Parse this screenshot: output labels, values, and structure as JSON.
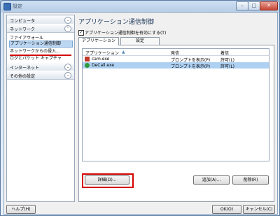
{
  "window": {
    "title": "設定"
  },
  "sidebar": {
    "categories": [
      {
        "label": "コンピュータ"
      },
      {
        "label": "ネットワーク"
      },
      {
        "label": "インターネット"
      },
      {
        "label": "その他の設定"
      }
    ],
    "network_items": [
      {
        "label": "ファイアウォール"
      },
      {
        "label": "アプリケーション通信制御"
      },
      {
        "label": "ネットワークからの侵入..."
      },
      {
        "label": "ログとパケット キャプチャ"
      }
    ]
  },
  "main": {
    "heading": "アプリケーション通信制御",
    "enable_checkbox": {
      "label": "アプリケーション通信制御を有効にする(T)",
      "checked": true
    },
    "tabs": [
      {
        "label": "アプリケーション"
      },
      {
        "label": "設定"
      }
    ],
    "list": {
      "columns": [
        "アプリケーション",
        "発信",
        "着信"
      ],
      "rows": [
        {
          "name": "cam.exe",
          "outbound": "プロンプトを表示(P)",
          "inbound": "許可(L)",
          "icon": "cam-app-icon",
          "selected": false
        },
        {
          "name": "DeCall.exe",
          "outbound": "プロンプトを表示(P)",
          "inbound": "許可(L)",
          "icon": "decall-app-icon",
          "selected": true
        }
      ]
    },
    "buttons": {
      "details": "詳細(D)...",
      "add": "追加(A)...",
      "remove": "削除(R)"
    }
  },
  "footer": {
    "help": "ヘルプ(H)",
    "ok": "OK(O)",
    "cancel": "キャンセル(C)"
  },
  "colors": {
    "highlight": "#d40000",
    "selection": "#aed0f2"
  }
}
